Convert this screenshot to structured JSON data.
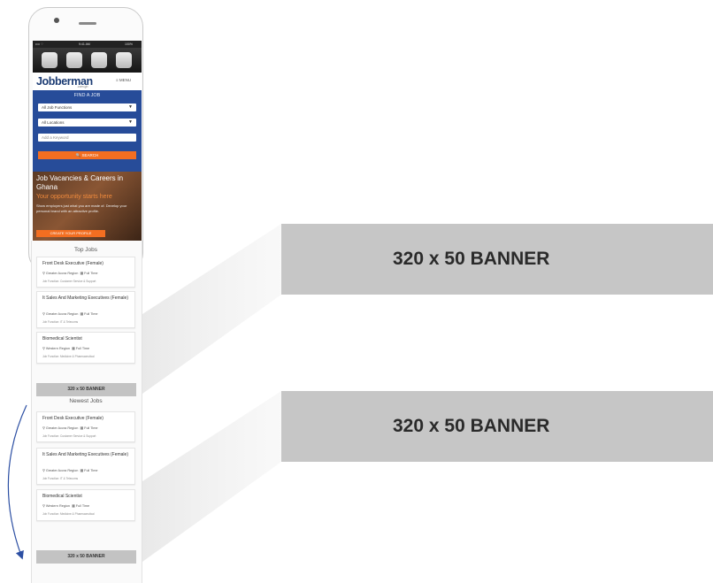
{
  "phone": {
    "status_bar": {
      "carrier": "•••• ⌔",
      "time": "9:41 AM",
      "battery": "100%"
    },
    "apps": [
      "app-icon-1",
      "app-icon-2",
      "app-icon-3",
      "camera-icon"
    ]
  },
  "header": {
    "logo": "Jobberman",
    "logo_sub": ".com.gh",
    "menu_label": "≡ MENU"
  },
  "search": {
    "title": "FIND A JOB",
    "job_functions": "All Job Functions",
    "locations": "All Locations",
    "keyword_placeholder": "Add a Keyword",
    "button": "🔍 SEARCH"
  },
  "hero": {
    "title": "Job Vacancies & Careers in Ghana",
    "subtitle": "Your opportunity starts here",
    "text": "Show employers just what you are made of. Develop your personal brand with an attractive profile.",
    "cta": "CREATE YOUR PROFILE"
  },
  "top_jobs": {
    "title": "Top Jobs",
    "jobs": [
      {
        "title": "Front Desk Executive (Female)",
        "location": "Greater Accra Region",
        "type": "Full Time",
        "function": "Job Function:   Customer Service & Support"
      },
      {
        "title": "It Sales And Marketing Executives (Female)",
        "location": "Greater Accra Region",
        "type": "Full Time",
        "function": "Job Function:   IT & Telecoms"
      },
      {
        "title": "Biomedical Scientist",
        "location": "Western Region",
        "type": "Full Time",
        "function": "Job Function:   Medicine & Pharmaceutical"
      }
    ]
  },
  "newest_jobs": {
    "title": "Newest Jobs",
    "jobs": [
      {
        "title": "Front Desk Executive (Female)",
        "location": "Greater Accra Region",
        "type": "Full Time",
        "function": "Job Function:   Customer Service & Support"
      },
      {
        "title": "It Sales And Marketing Executives (Female)",
        "location": "Greater Accra Region",
        "type": "Full Time",
        "function": "Job Function:   IT & Telecoms"
      },
      {
        "title": "Biomedical Scientist",
        "location": "Western Region",
        "type": "Full Time",
        "function": "Job Function:   Medicine & Pharmaceutical"
      }
    ]
  },
  "banners": {
    "small_1": "320 x 50 BANNER",
    "small_2": "320 x 50 BANNER",
    "large_1": "320 x 50 BANNER",
    "large_2": "320 x 50 BANNER"
  },
  "colors": {
    "brand_blue": "#274c99",
    "brand_orange": "#f36e21",
    "banner_grey": "#c6c6c6",
    "arrow_blue": "#2c4fa3"
  }
}
